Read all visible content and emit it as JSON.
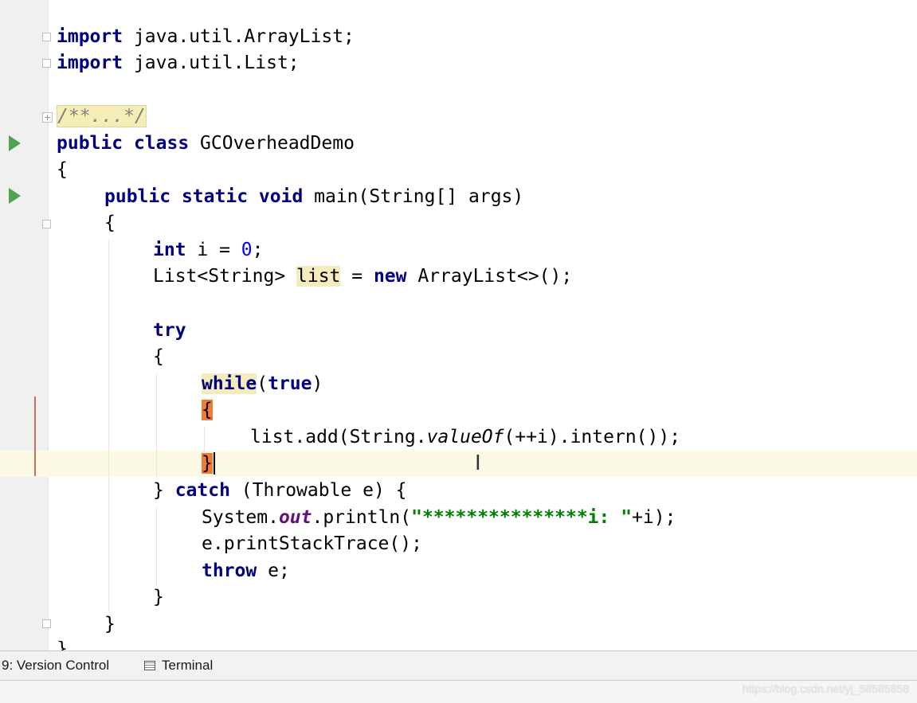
{
  "editor": {
    "lines": {
      "import1_kw": "import",
      "import1_rest": " java.util.ArrayList;",
      "import2_kw": "import",
      "import2_rest": " java.util.List;",
      "javadoc_fold": "/**...*/",
      "class_kw1": "public",
      "class_kw2": "class",
      "class_name": " GCOverheadDemo",
      "brace_open": "{",
      "main_kw1": "public",
      "main_kw2": "static",
      "main_kw3": "void",
      "main_rest": " main(String[] args)",
      "int_kw": "int",
      "int_rest": " i = ",
      "int_num": "0",
      "semicolon": ";",
      "list_decl": "List<String> ",
      "list_var": "list",
      "list_eq": " = ",
      "new_kw": "new",
      "list_rest": " ArrayList<>();",
      "try_kw": "try",
      "while_kw": "while",
      "while_paren_open": "(",
      "true_kw": "true",
      "while_paren_close": ")",
      "add_pre": "list.add(String.",
      "add_method": "valueOf",
      "add_post": "(++i).intern());",
      "brace_close": "}",
      "catch_pre": "} ",
      "catch_kw": "catch",
      "catch_rest": " (Throwable e) {",
      "println_pre": "System.",
      "println_field": "out",
      "println_mid": ".println(",
      "println_str": "\"***************i: \"",
      "println_post": "+i);",
      "stack_trace": "e.printStackTrace();",
      "throw_kw": "throw",
      "throw_rest": " e;"
    }
  },
  "toolbar": {
    "version_control_label": "9: Version Control",
    "terminal_label": "Terminal"
  },
  "watermark": "https://blog.csdn.net/yj_58585858"
}
